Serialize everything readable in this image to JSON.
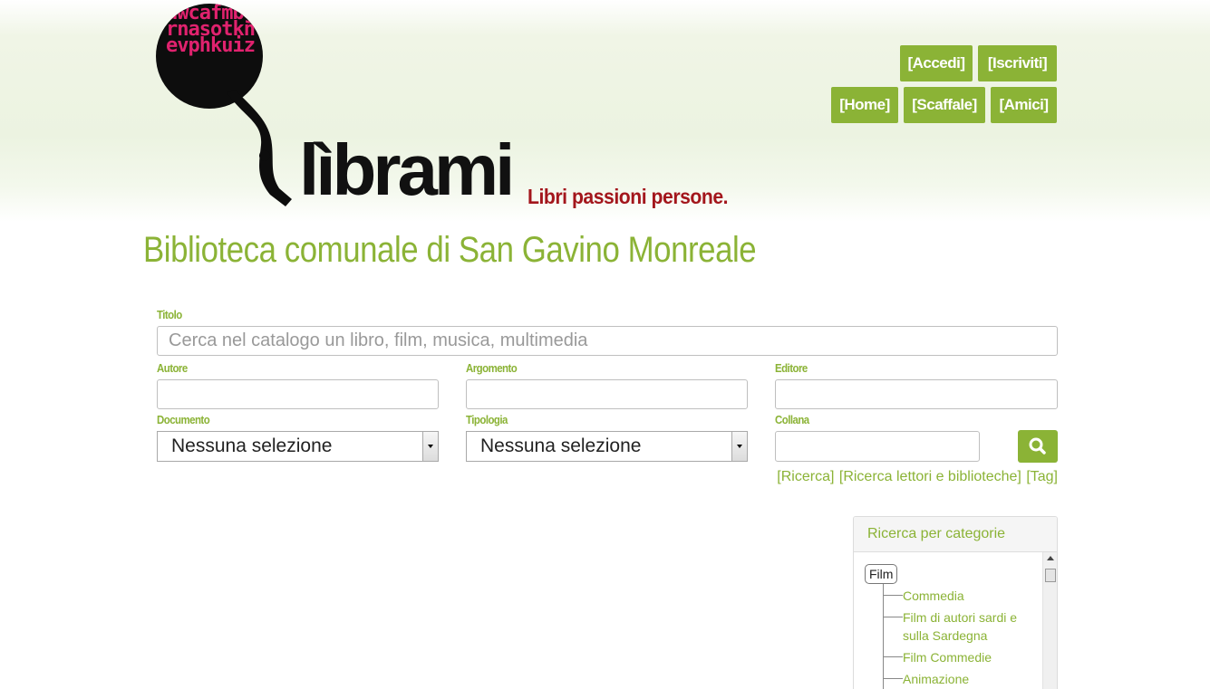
{
  "brand": {
    "logo_letters": "dwcafmbgrnasotknevphkuiz",
    "logo_word": "lìbrami",
    "tagline": "Libri passioni persone."
  },
  "nav": {
    "accedi": "[Accedi]",
    "iscriviti": "[Iscriviti]",
    "home": "[Home]",
    "scaffale": "[Scaffale]",
    "amici": "[Amici]"
  },
  "page": {
    "title": "Biblioteca comunale di San Gavino Monreale"
  },
  "search": {
    "titolo_label": "Titolo",
    "titolo_placeholder": "Cerca nel catalogo un libro, film, musica, multimedia",
    "autore_label": "Autore",
    "argomento_label": "Argomento",
    "editore_label": "Editore",
    "documento_label": "Documento",
    "documento_value": "Nessuna selezione",
    "tipologia_label": "Tipologia",
    "tipologia_value": "Nessuna selezione",
    "collana_label": "Collana"
  },
  "links": {
    "ricerca": "[Ricerca]",
    "ricerca_lettori": "[Ricerca lettori e biblioteche]",
    "tag": "[Tag]"
  },
  "categories": {
    "title": "Ricerca per categorie",
    "root": "Film",
    "items": [
      "Commedia",
      "Film di autori sardi e sulla Sardegna",
      "Film Commedie",
      "Animazione"
    ]
  }
}
